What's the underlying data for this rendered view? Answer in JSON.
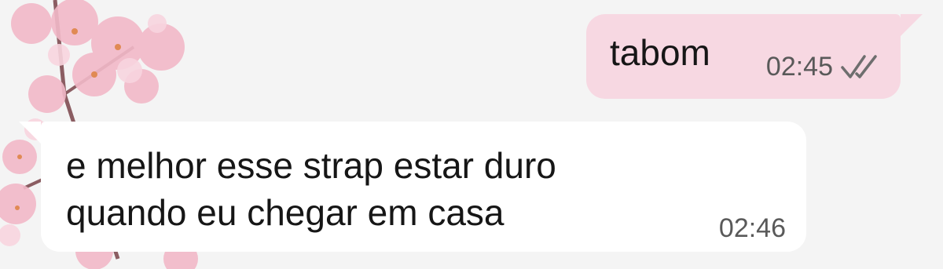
{
  "chat": {
    "messages": [
      {
        "direction": "outgoing",
        "text": "tabom",
        "time": "02:45",
        "status_icon": "double-check-icon"
      },
      {
        "direction": "incoming",
        "lines": [
          "e melhor esse strap estar duro",
          "quando eu chegar em casa"
        ],
        "time": "02:46"
      }
    ]
  },
  "colors": {
    "background": "#f4f4f4",
    "outgoing_bubble": "#f7d8e2",
    "incoming_bubble": "#ffffff",
    "text": "#161616",
    "meta_text": "#595959",
    "wallpaper_blossom": "#f2b9c8"
  },
  "wallpaper": {
    "icon": "cherry-blossom-icon"
  }
}
